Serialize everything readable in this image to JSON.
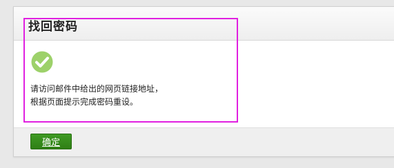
{
  "panel": {
    "title": "找回密码",
    "status_icon": "check-circle-icon",
    "message_lines": [
      "请访问邮件中给出的网页链接地址，",
      "根据页面提示完成密码重设。"
    ]
  },
  "footer": {
    "confirm_label": "确定"
  },
  "colors": {
    "check_icon": "#9dd16a",
    "button": "#338719",
    "highlight": "#e01fe0"
  }
}
